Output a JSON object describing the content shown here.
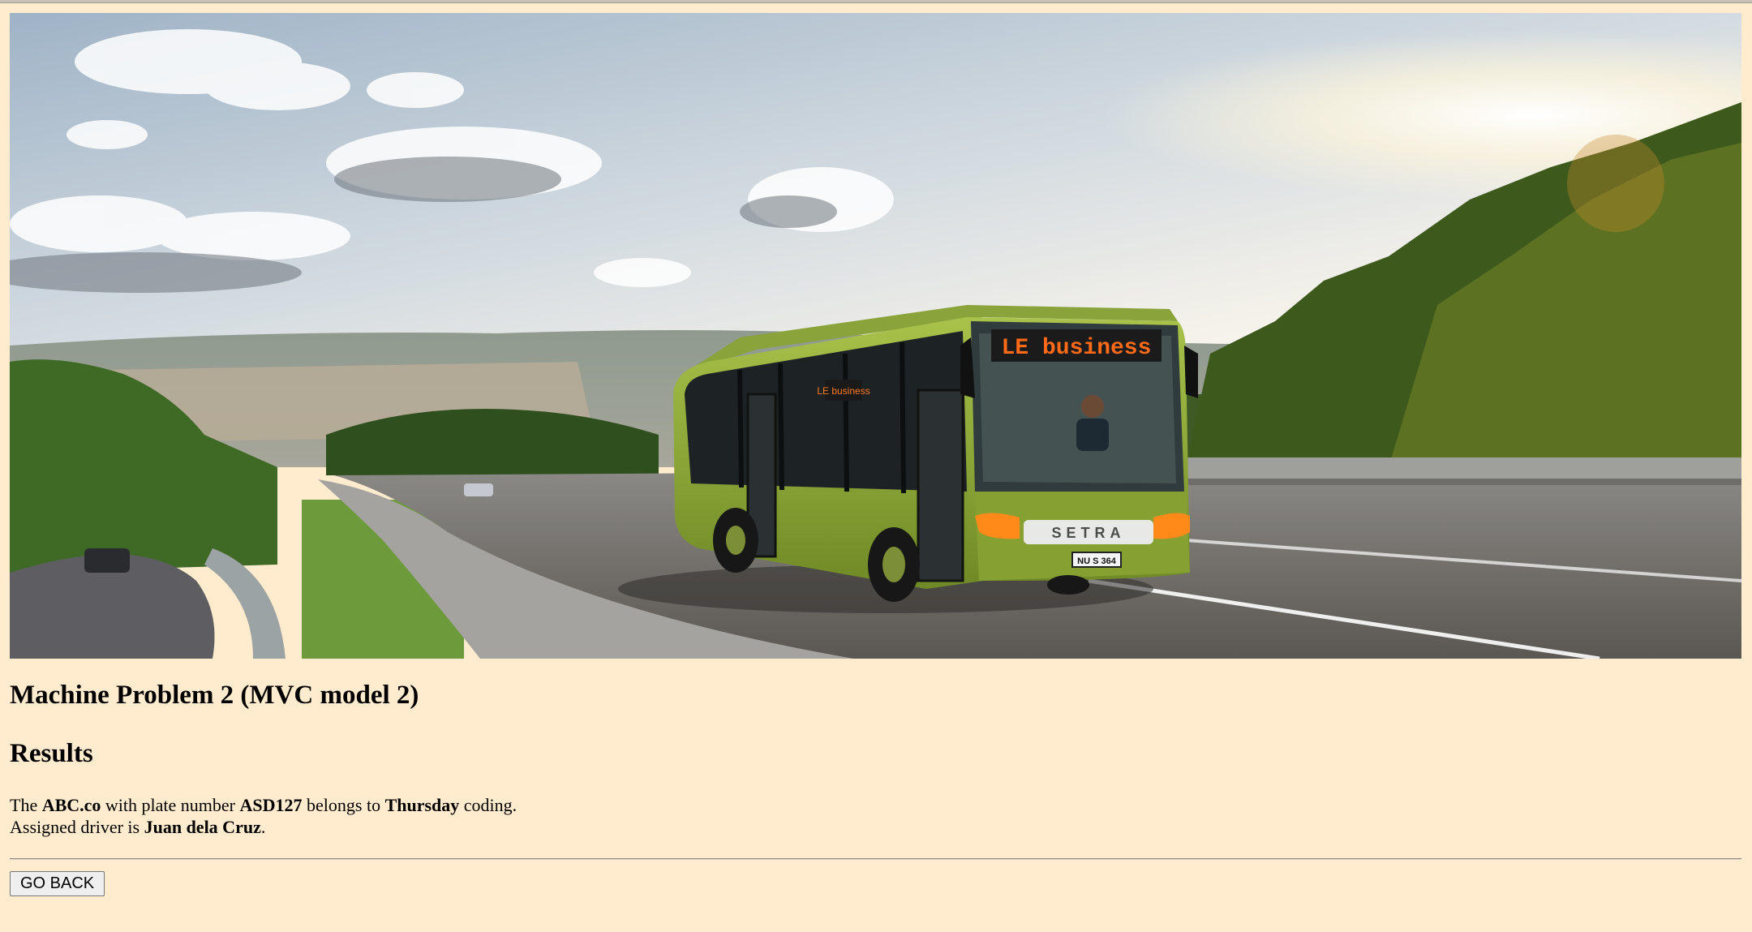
{
  "header": {
    "title": "Machine Problem 2 (MVC model 2)",
    "subtitle": "Results"
  },
  "banner": {
    "destination_sign": "LE business",
    "bus_brand": "SETRA",
    "plate_on_bus": "NU S 364"
  },
  "result": {
    "line1": {
      "prefix": "The ",
      "company": "ABC.co",
      "mid1": " with plate number ",
      "plate": "ASD127",
      "mid2": " belongs to ",
      "day": "Thursday",
      "suffix": " coding."
    },
    "line2": {
      "prefix": "Assigned driver is ",
      "driver": "Juan dela Cruz",
      "suffix": "."
    }
  },
  "actions": {
    "go_back_label": "GO BACK"
  }
}
